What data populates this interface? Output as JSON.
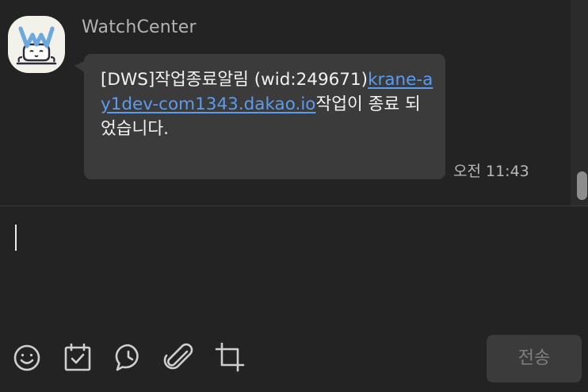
{
  "message": {
    "sender": "WatchCenter",
    "text_part1": "[DWS]작업종료알림 (wid:249671)",
    "link_text": "krane-ay1dev-com1343.dakao.io",
    "text_part2": "작업이 종료 되었습니다.",
    "time": "오전 11:43"
  },
  "composer": {
    "input_value": "",
    "send_label": "전송"
  },
  "toolbar": {
    "icons": [
      "emoji-icon",
      "calendar-check-icon",
      "speech-bubble-icon",
      "paperclip-icon",
      "crop-icon"
    ]
  },
  "colors": {
    "background": "#232323",
    "bubble": "#3b3b3b",
    "link": "#5b9bf0",
    "send_button": "#3b3b3b"
  }
}
